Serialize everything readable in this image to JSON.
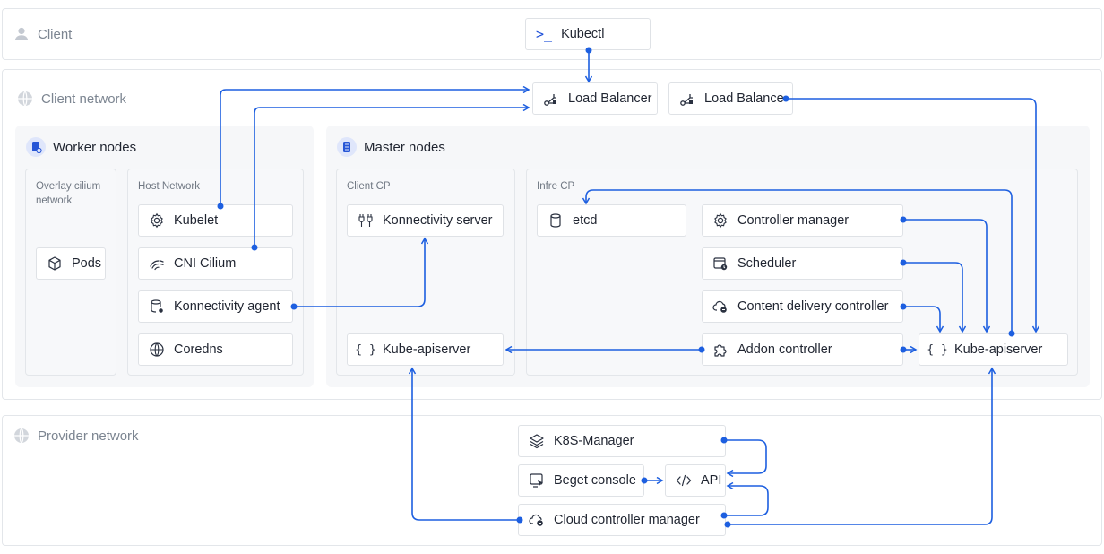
{
  "zones": {
    "client": "Client",
    "client_network": "Client network",
    "provider_network": "Provider network"
  },
  "panels": {
    "worker_nodes": "Worker nodes",
    "master_nodes": "Master nodes"
  },
  "groups": {
    "overlay": "Overlay cilium network",
    "host": "Host Network",
    "client_cp": "Client CP",
    "infra_cp": "Infre CP"
  },
  "nodes": {
    "kubectl": "Kubectl",
    "lb1": "Load Balancer",
    "lb2": "Load Balance",
    "pods": "Pods",
    "kubelet": "Kubelet",
    "cni": "CNI Cilium",
    "konn_agent": "Konnectivity agent",
    "coredns": "Coredns",
    "konn_server": "Konnectivity server",
    "apiserver_client": "Kube-apiserver",
    "etcd": "etcd",
    "ctrl_mgr": "Controller manager",
    "scheduler": "Scheduler",
    "cdc": "Content delivery controller",
    "addon": "Addon controller",
    "apiserver_infra": "Kube-apiserver",
    "k8s_mgr": "K8S-Manager",
    "beget": "Beget console",
    "api": "API",
    "ccm": "Cloud controller manager"
  },
  "icons": {
    "client": "user-icon",
    "network": "globe-icon",
    "kubectl": "terminal-prompt-icon",
    "load_balancer": "load-balancer-icon",
    "worker": "server-icon",
    "master": "server-stack-icon",
    "pods": "cube-icon",
    "kubelet": "gear-icon",
    "cni": "wifi-icon",
    "konn_agent": "database-link-icon",
    "coredns": "globe-icon",
    "konn_server": "plug-icon",
    "apiserver": "braces-icon",
    "etcd": "cylinder-icon",
    "ctrl_mgr": "gear-icon",
    "scheduler": "calendar-clock-icon",
    "cdc": "cloud-gear-icon",
    "addon": "puzzle-icon",
    "k8s_mgr": "layers-icon",
    "beget": "monitor-cursor-icon",
    "api": "code-icon",
    "ccm": "cloud-gear-icon"
  },
  "colors": {
    "connector": "#1d5fe0",
    "accent_badge": "#dfe6fb"
  }
}
